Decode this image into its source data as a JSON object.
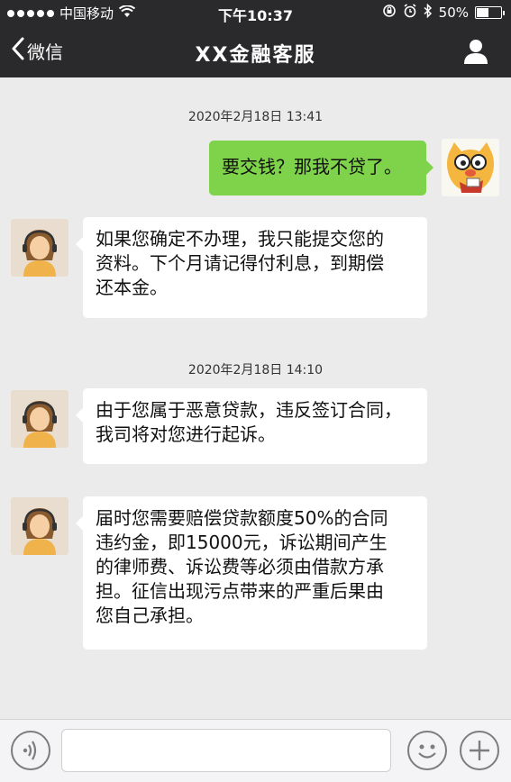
{
  "status_bar": {
    "carrier": "中国移动",
    "time": "下午10:37",
    "battery": "50%",
    "battery_level": 0.5
  },
  "nav": {
    "back_label": "微信",
    "title": "XX金融客服"
  },
  "chat": {
    "timestamps": [
      "2020年2月18日 13:41",
      "2020年2月18日 14:10"
    ],
    "messages": [
      {
        "side": "right",
        "text": "要交钱？那我不贷了。"
      },
      {
        "side": "left",
        "lines": [
          "如果您确定不办理，我只能提交您的",
          "资料。下个月请记得付利息，到期偿",
          "还本金。"
        ]
      },
      {
        "side": "left",
        "lines": [
          "由于您属于恶意贷款，违反签订合同，",
          "我司将对您进行起诉。"
        ]
      },
      {
        "side": "left",
        "lines": [
          "届时您需要赔偿贷款额度50%的合同",
          "违约金，即15000元，诉讼期间产生",
          "的律师费、诉讼费等必须由借款方承",
          "担。征信出现污点带来的严重后果由",
          "您自己承担。"
        ]
      }
    ]
  },
  "icons": {
    "signal": "signal-dots-icon",
    "wifi": "wifi-icon",
    "lock": "orientation-lock-icon",
    "alarm": "alarm-icon",
    "bluetooth": "bluetooth-icon",
    "back": "chevron-left-icon",
    "contact": "person-icon",
    "voice": "voice-icon",
    "emoji": "emoji-icon",
    "more": "plus-icon"
  }
}
